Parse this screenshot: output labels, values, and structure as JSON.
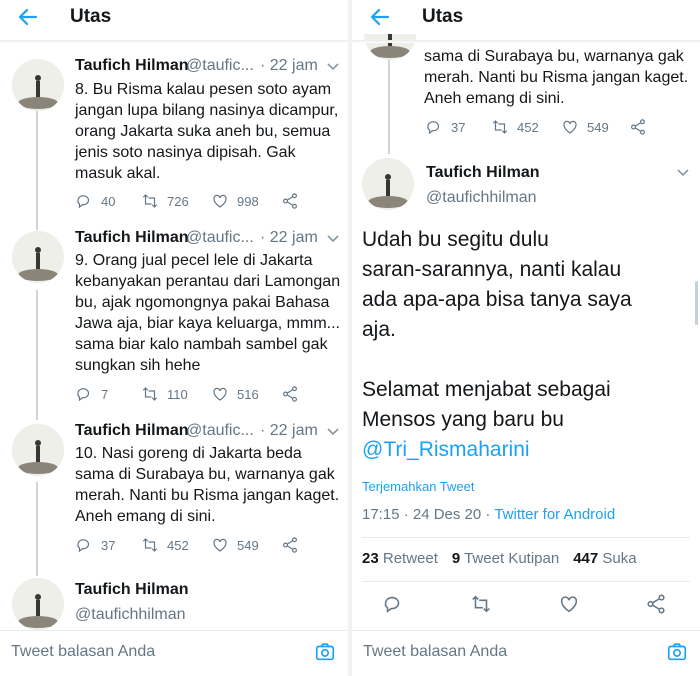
{
  "colors": {
    "accent": "#1da1f2",
    "text": "#14171a",
    "muted": "#657786",
    "border": "#e6ecf0"
  },
  "left": {
    "header": {
      "title": "Utas",
      "back_icon": "arrow-left-icon"
    },
    "tweets": [
      {
        "name": "Taufich Hilman",
        "handle": "@taufic...",
        "time": "· 22 jam",
        "lines": [
          "8. Bu Risma kalau pesen soto ayam",
          "jangan lupa bilang nasinya dicampur,",
          "orang Jakarta suka aneh bu, semua",
          "jenis soto nasinya dipisah. Gak",
          "masuk akal."
        ],
        "replies": "40",
        "retweets": "726",
        "likes": "998"
      },
      {
        "name": "Taufich Hilman",
        "handle": "@taufic...",
        "time": "· 22 jam",
        "lines": [
          "9. Orang jual pecel lele di Jakarta",
          "kebanyakan perantau dari Lamongan",
          "bu, ajak ngomongnya pakai Bahasa",
          "Jawa aja, biar kaya keluarga, mmm...",
          "sama biar kalo nambah sambel gak",
          "sungkan sih hehe"
        ],
        "replies": "7",
        "retweets": "110",
        "likes": "516"
      },
      {
        "name": "Taufich Hilman",
        "handle": "@taufic...",
        "time": "· 22 jam",
        "lines": [
          "10. Nasi goreng di Jakarta beda",
          "sama di Surabaya bu, warnanya gak",
          "merah. Nanti bu Risma jangan kaget.",
          "Aneh emang di sini."
        ],
        "replies": "37",
        "retweets": "452",
        "likes": "549"
      },
      {
        "name": "Taufich Hilman",
        "handle": "@taufichhilman"
      }
    ],
    "reply_placeholder": "Tweet balasan Anda"
  },
  "right": {
    "header": {
      "title": "Utas"
    },
    "prev_tweet": {
      "lines": [
        "sama di Surabaya bu, warnanya gak",
        "merah. Nanti bu Risma jangan kaget.",
        "Aneh emang di sini."
      ],
      "replies": "37",
      "retweets": "452",
      "likes": "549"
    },
    "main_tweet": {
      "name": "Taufich Hilman",
      "handle": "@taufichhilman",
      "lines": [
        "Udah bu segitu dulu",
        "saran-sarannya, nanti kalau",
        "ada apa-apa bisa tanya saya",
        "aja.",
        "",
        "Selamat menjabat sebagai",
        "Mensos yang baru bu"
      ],
      "mention": "@Tri_Rismaharini",
      "translate": "Terjemahkan Tweet",
      "timestamp": "17:15 · 24 Des 20 · ",
      "source": "Twitter for Android",
      "retweet_count": "23",
      "retweet_label": "Retweet",
      "quote_count": "9",
      "quote_label": "Tweet Kutipan",
      "like_count": "447",
      "like_label": "Suka"
    },
    "reply_placeholder": "Tweet balasan Anda"
  }
}
